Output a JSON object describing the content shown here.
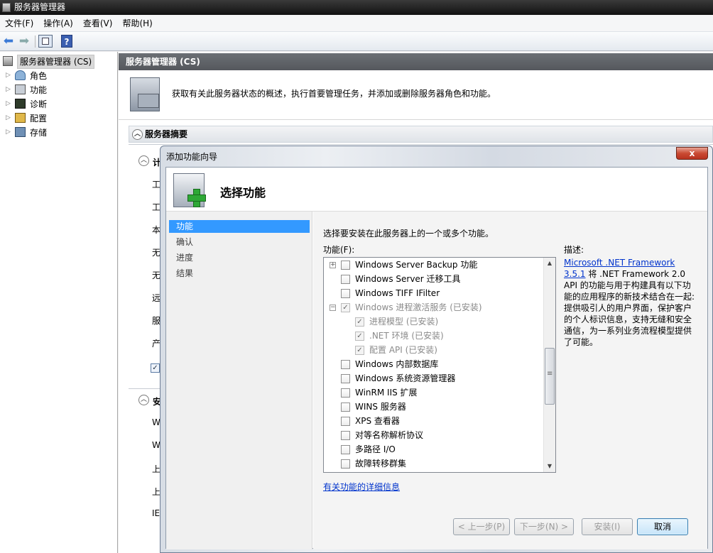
{
  "window": {
    "title": "服务器管理器"
  },
  "menu": [
    "文件(F)",
    "操作(A)",
    "查看(V)",
    "帮助(H)"
  ],
  "tree": {
    "root": "服务器管理器 (CS)",
    "items": [
      "角色",
      "功能",
      "诊断",
      "配置",
      "存储"
    ]
  },
  "main": {
    "header": "服务器管理器 (CS)",
    "banner_text": "获取有关此服务器状态的概述，执行首要管理任务，并添加或删除服务器角色和功能。",
    "summary_title": "服务器摘要",
    "sub1": "计",
    "sub2": "安",
    "frags": [
      "计",
      "工",
      "本",
      "无",
      "无",
      "远",
      "服",
      "产",
      "W",
      "W",
      "上",
      "上",
      "IE"
    ]
  },
  "dialog": {
    "title": "添加功能向导",
    "close": "x",
    "heading": "选择功能",
    "steps": [
      "功能",
      "确认",
      "进度",
      "结果"
    ],
    "instruction": "选择要安装在此服务器上的一个或多个功能。",
    "list_label": "功能(F):",
    "features": [
      {
        "label": "Windows Server Backup 功能",
        "check": "",
        "toggle": "+"
      },
      {
        "label": "Windows Server 迁移工具",
        "check": ""
      },
      {
        "label": "Windows TIFF IFilter",
        "check": ""
      },
      {
        "label": "Windows 进程激活服务 (已安装)",
        "check": "✓",
        "toggle": "−"
      },
      {
        "label": "进程模型 (已安装)",
        "check": "✓"
      },
      {
        "label": ".NET 环境 (已安装)",
        "check": "✓"
      },
      {
        "label": "配置 API (已安装)",
        "check": "✓"
      },
      {
        "label": "Windows 内部数据库",
        "check": ""
      },
      {
        "label": "Windows 系统资源管理器",
        "check": ""
      },
      {
        "label": "WinRM IIS 扩展",
        "check": ""
      },
      {
        "label": "WINS 服务器",
        "check": ""
      },
      {
        "label": "XPS 查看器",
        "check": ""
      },
      {
        "label": "对等名称解析协议",
        "check": ""
      },
      {
        "label": "多路径 I/O",
        "check": ""
      },
      {
        "label": "故障转移群集",
        "check": ""
      }
    ],
    "desc_label": "描述:",
    "desc_link": "Microsoft .NET Framework 3.5.1",
    "desc_text": " 将 .NET Framework 2.0 API 的功能与用于构建具有以下功能的应用程序的新技术结合在一起: 提供吸引人的用户界面，保护客户的个人标识信息，支持无缝和安全通信，为一系列业务流程模型提供了可能。",
    "more_link": "有关功能的详细信息",
    "buttons": {
      "prev": "< 上一步(P)",
      "next": "下一步(N) >",
      "install": "安装(I)",
      "cancel": "取消"
    }
  },
  "colors": {
    "selection": "#3399ff",
    "link": "#0033cc",
    "title_bg": "#222222"
  }
}
